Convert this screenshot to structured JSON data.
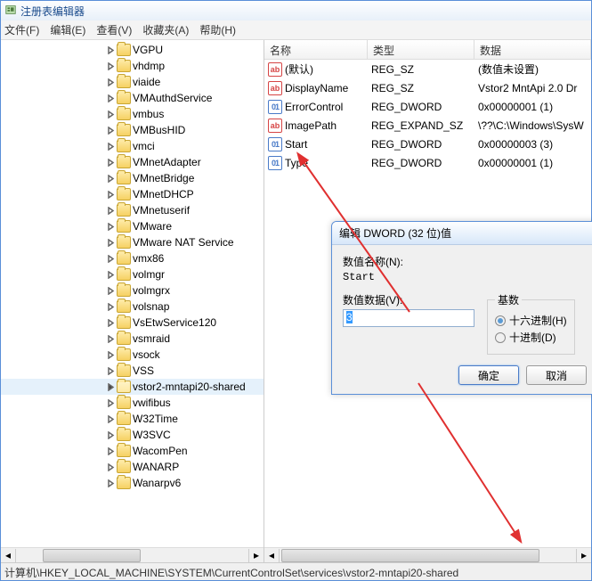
{
  "window": {
    "title": "注册表编辑器"
  },
  "menu": {
    "file": "文件(F)",
    "edit": "编辑(E)",
    "view": "查看(V)",
    "favorites": "收藏夹(A)",
    "help": "帮助(H)"
  },
  "tree": [
    "VGPU",
    "vhdmp",
    "viaide",
    "VMAuthdService",
    "vmbus",
    "VMBusHID",
    "vmci",
    "VMnetAdapter",
    "VMnetBridge",
    "VMnetDHCP",
    "VMnetuserif",
    "VMware",
    "VMware NAT Service",
    "vmx86",
    "volmgr",
    "volmgrx",
    "volsnap",
    "VsEtwService120",
    "vsmraid",
    "vsock",
    "VSS",
    "vstor2-mntapi20-shared",
    "vwifibus",
    "W32Time",
    "W3SVC",
    "WacomPen",
    "WANARP",
    "Wanarpv6"
  ],
  "selectedIndex": 21,
  "columns": {
    "name": "名称",
    "type": "类型",
    "data": "数据"
  },
  "values": [
    {
      "name": "(默认)",
      "type": "REG_SZ",
      "data": "(数值未设置)",
      "icon": "sz"
    },
    {
      "name": "DisplayName",
      "type": "REG_SZ",
      "data": "Vstor2 MntApi 2.0 Dr",
      "icon": "sz"
    },
    {
      "name": "ErrorControl",
      "type": "REG_DWORD",
      "data": "0x00000001 (1)",
      "icon": "dw"
    },
    {
      "name": "ImagePath",
      "type": "REG_EXPAND_SZ",
      "data": "\\??\\C:\\Windows\\SysW",
      "icon": "sz"
    },
    {
      "name": "Start",
      "type": "REG_DWORD",
      "data": "0x00000003 (3)",
      "icon": "dw"
    },
    {
      "name": "Type",
      "type": "REG_DWORD",
      "data": "0x00000001 (1)",
      "icon": "dw"
    }
  ],
  "dialog": {
    "title": "编辑 DWORD (32 位)值",
    "nameLabel": "数值名称(N):",
    "name": "Start",
    "dataLabel": "数值数据(V):",
    "data": "3",
    "baseLabel": "基数",
    "hex": "十六进制(H)",
    "dec": "十进制(D)",
    "ok": "确定",
    "cancel": "取消"
  },
  "statusbar": "计算机\\HKEY_LOCAL_MACHINE\\SYSTEM\\CurrentControlSet\\services\\vstor2-mntapi20-shared"
}
